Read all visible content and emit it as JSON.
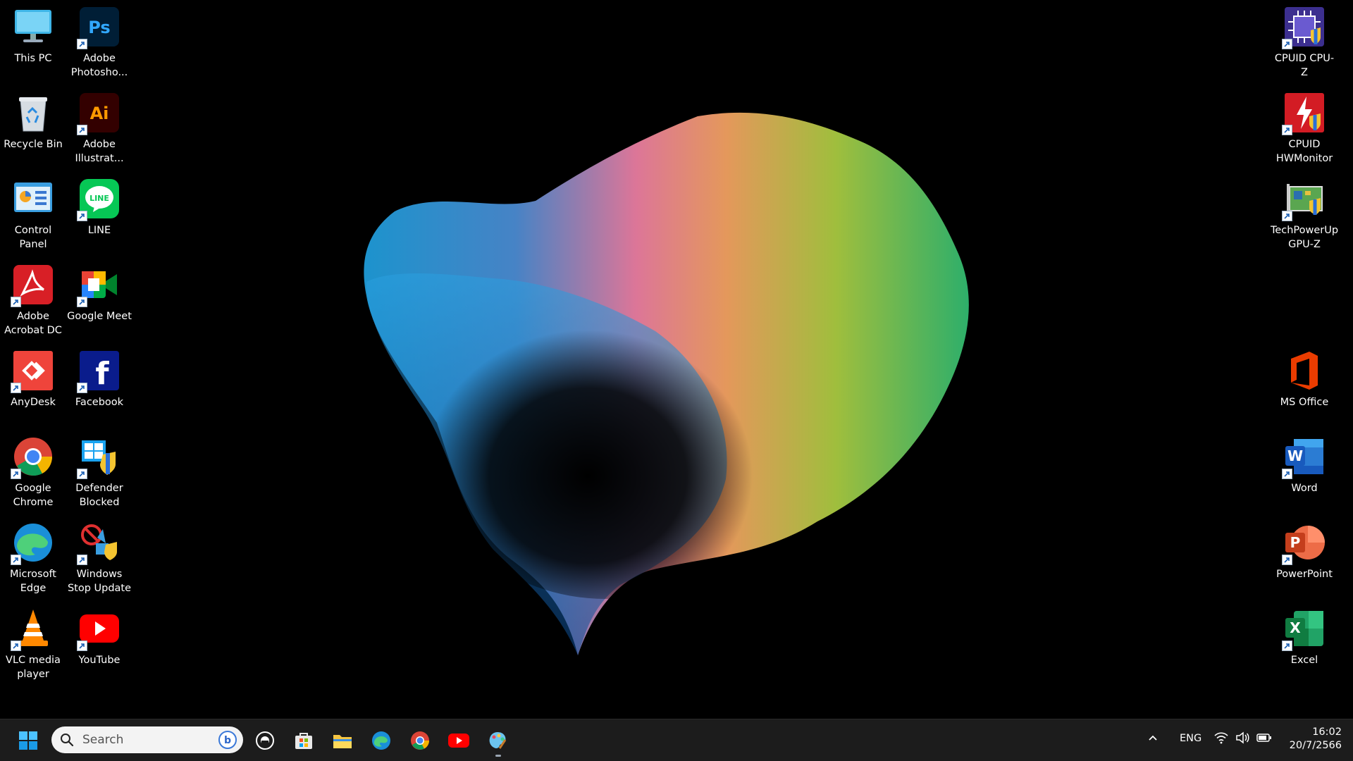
{
  "desktop": {
    "left_column_1": [
      {
        "id": "this-pc",
        "label": "This PC",
        "icon": "monitor-icon",
        "shortcut": false
      },
      {
        "id": "recycle-bin",
        "label": "Recycle Bin",
        "icon": "recycle-bin-icon",
        "shortcut": false
      },
      {
        "id": "control-panel",
        "label": "Control Panel",
        "icon": "control-panel-icon",
        "shortcut": false
      },
      {
        "id": "acrobat",
        "label": "Adobe Acrobat DC",
        "icon": "acrobat-icon",
        "shortcut": true
      },
      {
        "id": "anydesk",
        "label": "AnyDesk",
        "icon": "anydesk-icon",
        "shortcut": true
      },
      {
        "id": "chrome",
        "label": "Google Chrome",
        "icon": "chrome-icon",
        "shortcut": true
      },
      {
        "id": "edge",
        "label": "Microsoft Edge",
        "icon": "edge-icon",
        "shortcut": true
      },
      {
        "id": "vlc",
        "label": "VLC media player",
        "icon": "vlc-icon",
        "shortcut": true
      }
    ],
    "left_column_2": [
      {
        "id": "photoshop",
        "label": "Adobe Photosho...",
        "icon": "photoshop-icon",
        "shortcut": true,
        "glyph": "Ps"
      },
      {
        "id": "illustrator",
        "label": "Adobe Illustrat...",
        "icon": "illustrator-icon",
        "shortcut": true,
        "glyph": "Ai"
      },
      {
        "id": "line",
        "label": "LINE",
        "icon": "line-icon",
        "shortcut": true,
        "glyph": "LINE"
      },
      {
        "id": "google-meet",
        "label": "Google Meet",
        "icon": "google-meet-icon",
        "shortcut": true
      },
      {
        "id": "facebook",
        "label": "Facebook",
        "icon": "facebook-icon",
        "shortcut": true,
        "glyph": "f"
      },
      {
        "id": "defender-blocked",
        "label": "Defender Blocked",
        "icon": "defender-icon",
        "shortcut": true
      },
      {
        "id": "windows-stop-update",
        "label": "Windows Stop Update",
        "icon": "stop-update-icon",
        "shortcut": true
      },
      {
        "id": "youtube",
        "label": "YouTube",
        "icon": "youtube-icon",
        "shortcut": true
      }
    ],
    "right_column": [
      {
        "id": "cpu-z",
        "label": "CPUID CPU-Z",
        "icon": "cpu-z-icon",
        "shortcut": true
      },
      {
        "id": "hwmonitor",
        "label": "CPUID HWMonitor",
        "icon": "hwmonitor-icon",
        "shortcut": true
      },
      {
        "id": "gpu-z",
        "label": "TechPowerUp GPU-Z",
        "icon": "gpu-z-icon",
        "shortcut": true
      },
      {
        "id": "ms-office",
        "label": "MS Office",
        "icon": "office-icon",
        "shortcut": false
      },
      {
        "id": "word",
        "label": "Word",
        "icon": "word-icon",
        "shortcut": true,
        "glyph": "W"
      },
      {
        "id": "powerpoint",
        "label": "PowerPoint",
        "icon": "powerpoint-icon",
        "shortcut": true,
        "glyph": "P"
      },
      {
        "id": "excel",
        "label": "Excel",
        "icon": "excel-icon",
        "shortcut": true,
        "glyph": "X"
      }
    ]
  },
  "taskbar": {
    "search_placeholder": "Search",
    "pinned": [
      "start-icon",
      "search",
      "task-view-icon",
      "store-icon",
      "file-explorer-icon",
      "edge-icon",
      "chrome-icon",
      "youtube-icon",
      "paint-icon"
    ],
    "tray": {
      "language": "ENG",
      "time": "16:02",
      "date": "20/7/2566"
    }
  },
  "colors": {
    "taskbar_bg": "#1c1c1c",
    "desktop_bg": "#000000",
    "windows_blue": "#0078d4"
  }
}
